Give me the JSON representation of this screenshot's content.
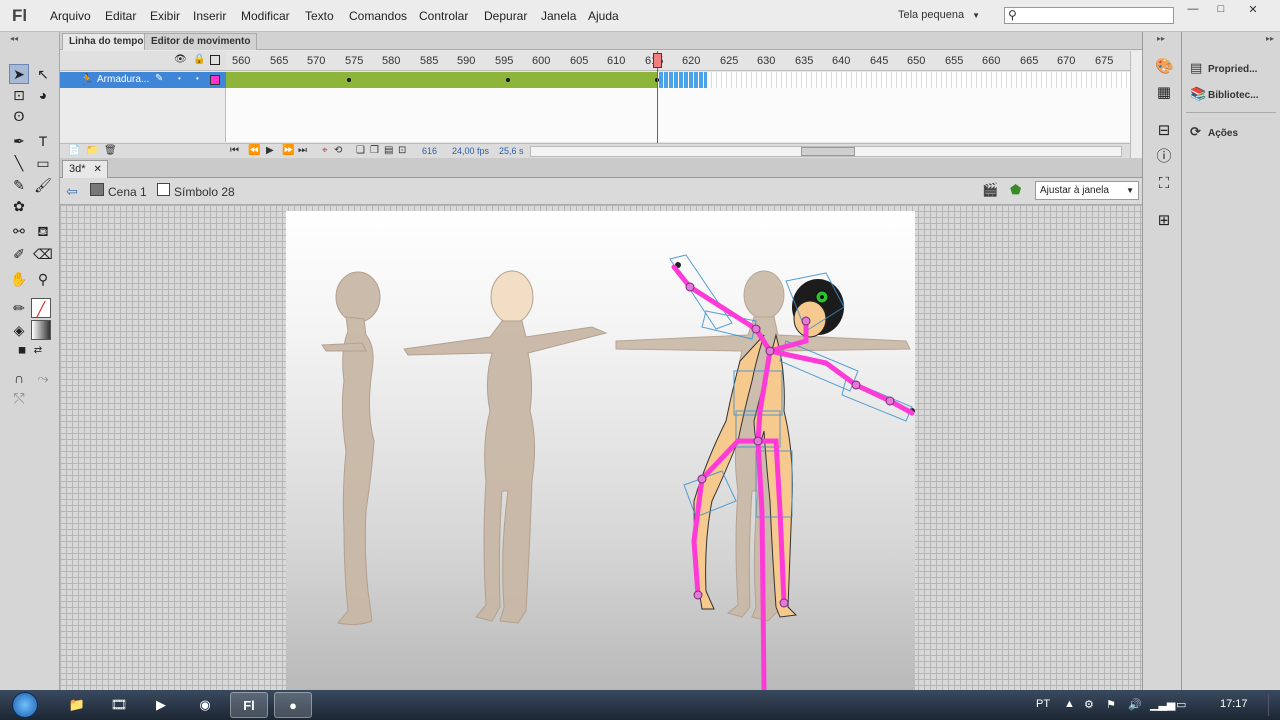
{
  "app": {
    "logo": "Fl"
  },
  "menu": [
    "Arquivo",
    "Editar",
    "Exibir",
    "Inserir",
    "Modificar",
    "Texto",
    "Comandos",
    "Controlar",
    "Depurar",
    "Janela",
    "Ajuda"
  ],
  "workspace": {
    "label": "Tela pequena"
  },
  "window_controls": [
    "—",
    "□",
    "✕"
  ],
  "timeline": {
    "tabs": [
      "Linha do tempo",
      "Editor de movimento"
    ],
    "layer": {
      "name": "Armadura..."
    },
    "frame_numbers": [
      "560",
      "565",
      "570",
      "575",
      "580",
      "585",
      "590",
      "595",
      "600",
      "605",
      "610",
      "615",
      "620",
      "625",
      "630",
      "635",
      "640",
      "645",
      "650",
      "655",
      "660",
      "665",
      "670",
      "675"
    ],
    "current_frame": "616",
    "fps": "24,00 fps",
    "time": "25,6 s",
    "span": {
      "first_frame": 556,
      "last_frame": 615,
      "playhead_frame": 615,
      "preview_end_frame": 622
    }
  },
  "document": {
    "tab_label": "3d*",
    "tab_close": "✕"
  },
  "edit_bar": {
    "scene_label": "Cena 1",
    "symbol_label": "Símbolo 28",
    "zoom_label": "Ajustar à janela"
  },
  "right_panel": {
    "items": [
      "Propried...",
      "Bibliotec...",
      "Ações"
    ]
  },
  "taskbar": {
    "apps": [
      "explorer",
      "media",
      "player",
      "chrome",
      "flash",
      "record"
    ],
    "tray": {
      "language": "PT",
      "clock": "17:17"
    }
  },
  "colors": {
    "tween_span": "#8db53a",
    "selection": "#3f86d8",
    "bone": "#ff3ad6",
    "playhead": "#dd3333",
    "layer_color": "#ff33cc"
  }
}
